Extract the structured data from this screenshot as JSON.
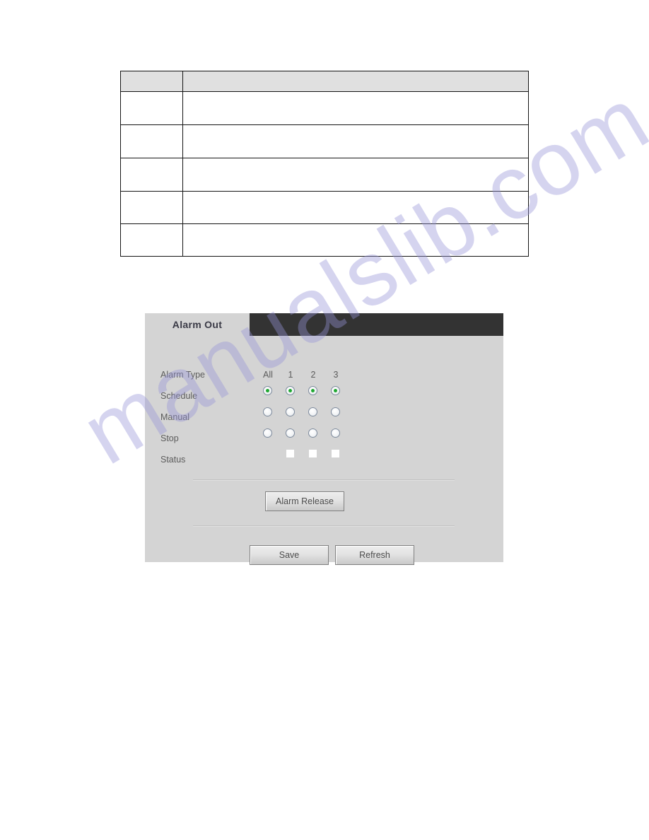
{
  "document": {
    "spec_table": {
      "columns": [
        "",
        ""
      ],
      "rows": [
        {
          "parameter": "",
          "description": ""
        },
        {
          "parameter": "",
          "description": ""
        },
        {
          "parameter": "",
          "description": ""
        },
        {
          "parameter": "",
          "description": ""
        },
        {
          "parameter": "",
          "description": ""
        }
      ]
    },
    "watermark": "manualslib.com"
  },
  "ui_panel": {
    "tab": {
      "label": "Alarm Out"
    },
    "columns": [
      "All",
      "1",
      "2",
      "3"
    ],
    "rows": [
      {
        "label": "Alarm Type"
      },
      {
        "label": "Schedule"
      },
      {
        "label": "Manual"
      },
      {
        "label": "Stop"
      },
      {
        "label": "Status"
      }
    ],
    "radio_state": {
      "schedule": [
        true,
        true,
        true,
        true
      ],
      "manual": [
        false,
        false,
        false,
        false
      ],
      "stop": [
        false,
        false,
        false,
        false
      ]
    },
    "status_indicators": [
      "off",
      "off",
      "off"
    ],
    "buttons": {
      "alarm_release": "Alarm Release",
      "save": "Save",
      "refresh": "Refresh"
    },
    "colors": {
      "tabbar_bg": "#333333",
      "panel_bg": "#d4d4d4",
      "radio_selected": "#20a832",
      "label_text": "#5c5c5c",
      "watermark": "#9694d8"
    }
  }
}
